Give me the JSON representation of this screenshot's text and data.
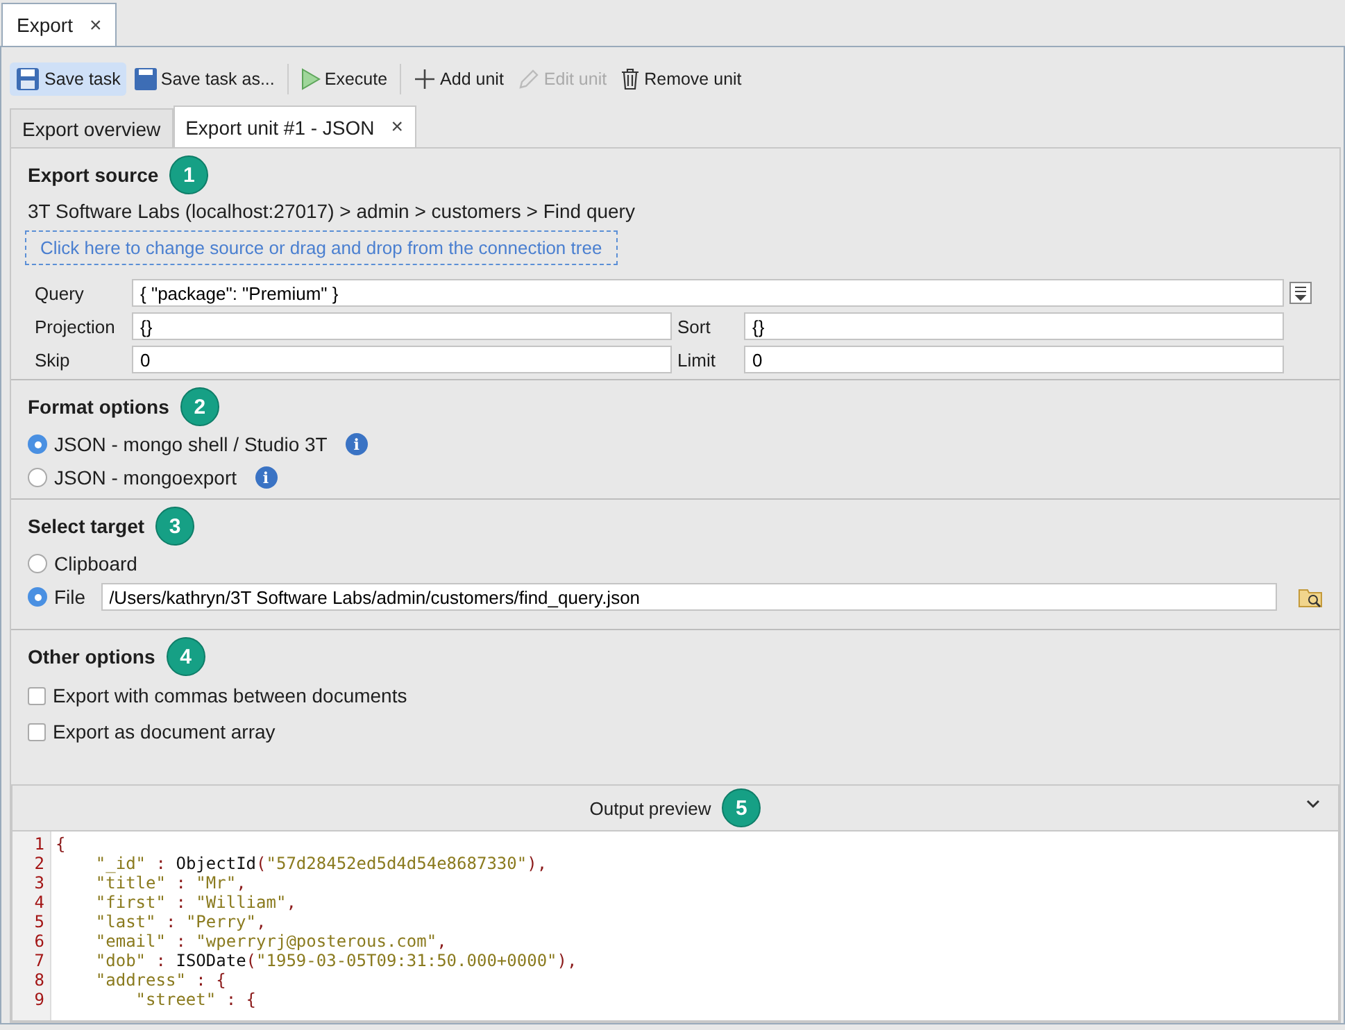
{
  "window_tab": {
    "label": "Export",
    "close": "×"
  },
  "toolbar": [
    {
      "kind": "save",
      "label": "Save task",
      "disabled": false,
      "selected": true
    },
    {
      "kind": "save_as",
      "label": "Save task as...",
      "disabled": false,
      "selected": false
    },
    {
      "kind": "execute",
      "label": "Execute",
      "disabled": false,
      "selected": false
    },
    {
      "kind": "add",
      "label": "Add unit",
      "disabled": false,
      "selected": false
    },
    {
      "kind": "edit",
      "label": "Edit unit",
      "disabled": true,
      "selected": false
    },
    {
      "kind": "remove",
      "label": "Remove unit",
      "disabled": false,
      "selected": false
    }
  ],
  "tabs": [
    {
      "label": "Export overview",
      "selected": false
    },
    {
      "label": "Export unit #1 - JSON",
      "selected": true,
      "close": "×"
    }
  ],
  "export_source": {
    "title": "Export source",
    "step": "1",
    "path": "3T Software Labs (localhost:27017) > admin > customers > Find query",
    "drop_zone": "Click here to change source or drag and drop from the connection tree",
    "query": {
      "label": "Query",
      "value": "{ \"package\": \"Premium\" }"
    },
    "projection": {
      "label": "Projection",
      "value": "{}"
    },
    "sort": {
      "label": "Sort",
      "value": "{}"
    },
    "skip": {
      "label": "Skip",
      "value": "0"
    },
    "limit": {
      "label": "Limit",
      "value": "0"
    }
  },
  "format_options": {
    "title": "Format options",
    "step": "2",
    "options": [
      {
        "label": "JSON - mongo shell / Studio 3T",
        "selected": true,
        "info": "i"
      },
      {
        "label": "JSON - mongoexport",
        "selected": false,
        "info": "i"
      }
    ]
  },
  "select_target": {
    "title": "Select target",
    "step": "3",
    "options": [
      {
        "label": "Clipboard",
        "selected": false
      },
      {
        "label": "File",
        "selected": true,
        "path": "/Users/kathryn/3T Software Labs/admin/customers/find_query.json"
      }
    ]
  },
  "other_options": {
    "title": "Other options",
    "step": "4",
    "options": [
      {
        "label": "Export with commas between documents",
        "checked": false
      },
      {
        "label": "Export as document array",
        "checked": false
      }
    ]
  },
  "output_preview": {
    "title": "Output preview",
    "step": "5",
    "expanded": true,
    "lines": [
      {
        "number": "1",
        "tokens": [
          {
            "kind": "punct",
            "text": "{"
          }
        ]
      },
      {
        "number": "2",
        "tokens": [
          {
            "kind": "key",
            "text": "    \"_id\""
          },
          {
            "kind": "punct",
            "text": " : "
          },
          {
            "kind": "func",
            "text": "ObjectId"
          },
          {
            "kind": "punct",
            "text": "("
          },
          {
            "kind": "string",
            "text": "\"57d28452ed5d4d54e8687330\""
          },
          {
            "kind": "punct",
            "text": "),"
          }
        ]
      },
      {
        "number": "3",
        "tokens": [
          {
            "kind": "key",
            "text": "    \"title\""
          },
          {
            "kind": "punct",
            "text": " : "
          },
          {
            "kind": "string",
            "text": "\"Mr\""
          },
          {
            "kind": "punct",
            "text": ","
          }
        ]
      },
      {
        "number": "4",
        "tokens": [
          {
            "kind": "key",
            "text": "    \"first\""
          },
          {
            "kind": "punct",
            "text": " : "
          },
          {
            "kind": "string",
            "text": "\"William\""
          },
          {
            "kind": "punct",
            "text": ","
          }
        ]
      },
      {
        "number": "5",
        "tokens": [
          {
            "kind": "key",
            "text": "    \"last\""
          },
          {
            "kind": "punct",
            "text": " : "
          },
          {
            "kind": "string",
            "text": "\"Perry\""
          },
          {
            "kind": "punct",
            "text": ","
          }
        ]
      },
      {
        "number": "6",
        "tokens": [
          {
            "kind": "key",
            "text": "    \"email\""
          },
          {
            "kind": "punct",
            "text": " : "
          },
          {
            "kind": "string",
            "text": "\"wperryrj@posterous.com\""
          },
          {
            "kind": "punct",
            "text": ","
          }
        ]
      },
      {
        "number": "7",
        "tokens": [
          {
            "kind": "key",
            "text": "    \"dob\""
          },
          {
            "kind": "punct",
            "text": " : "
          },
          {
            "kind": "func",
            "text": "ISODate"
          },
          {
            "kind": "punct",
            "text": "("
          },
          {
            "kind": "string",
            "text": "\"1959-03-05T09:31:50.000+0000\""
          },
          {
            "kind": "punct",
            "text": "),"
          }
        ]
      },
      {
        "number": "8",
        "tokens": [
          {
            "kind": "key",
            "text": "    \"address\""
          },
          {
            "kind": "punct",
            "text": " : {"
          }
        ]
      },
      {
        "number": "9",
        "tokens": [
          {
            "kind": "key",
            "text": "        \"street\""
          },
          {
            "kind": "punct",
            "text": " : {"
          }
        ]
      }
    ]
  }
}
